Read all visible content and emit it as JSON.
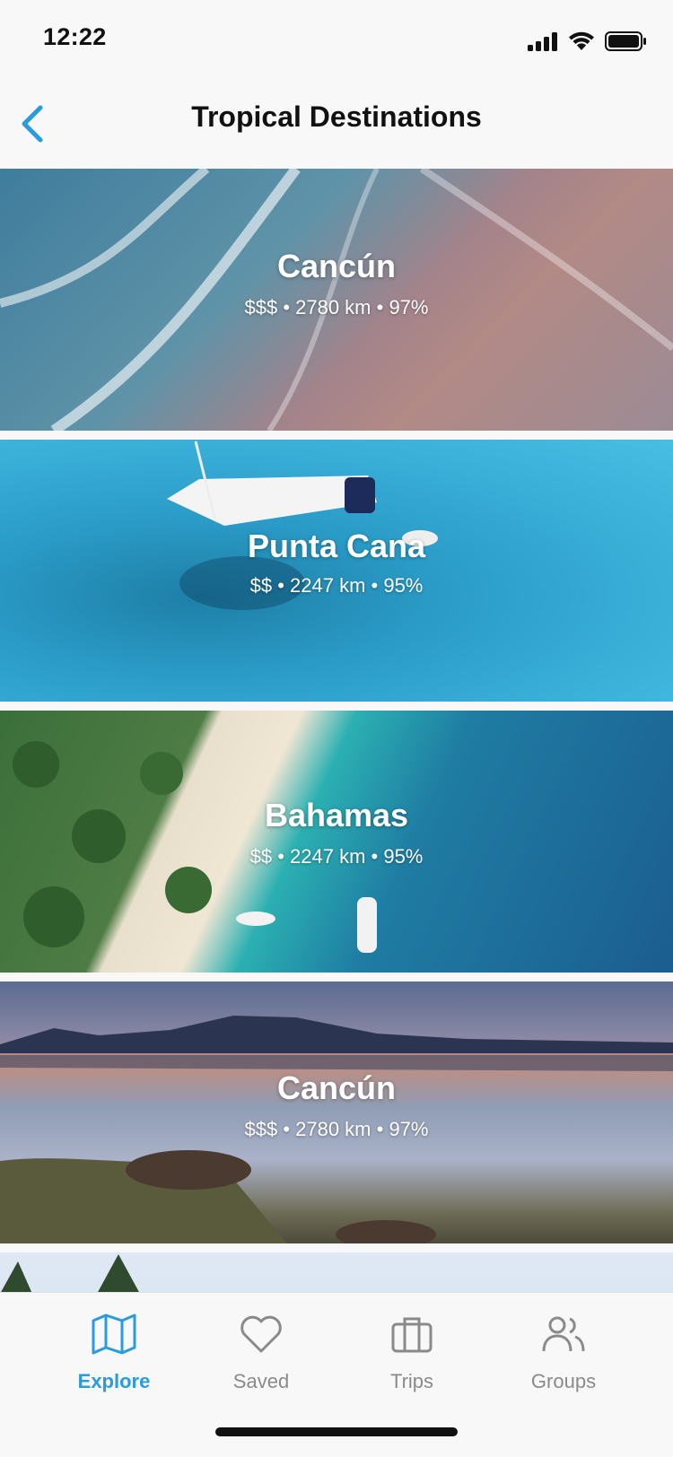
{
  "status_bar": {
    "time": "12:22"
  },
  "header": {
    "title": "Tropical Destinations"
  },
  "destinations": [
    {
      "name": "Cancún",
      "meta": "$$$ • 2780 km •  97%"
    },
    {
      "name": "Punta Cana",
      "meta": "$$ • 2247 km •  95%"
    },
    {
      "name": "Bahamas",
      "meta": "$$ • 2247 km •  95%"
    },
    {
      "name": "Cancún",
      "meta": "$$$ • 2780 km •  97%"
    }
  ],
  "tabs": [
    {
      "label": "Explore",
      "icon": "map-icon",
      "active": true
    },
    {
      "label": "Saved",
      "icon": "heart-icon",
      "active": false
    },
    {
      "label": "Trips",
      "icon": "briefcase-icon",
      "active": false
    },
    {
      "label": "Groups",
      "icon": "users-icon",
      "active": false
    }
  ],
  "colors": {
    "accent": "#2a9bdf",
    "inactive": "#8a8a8a"
  }
}
